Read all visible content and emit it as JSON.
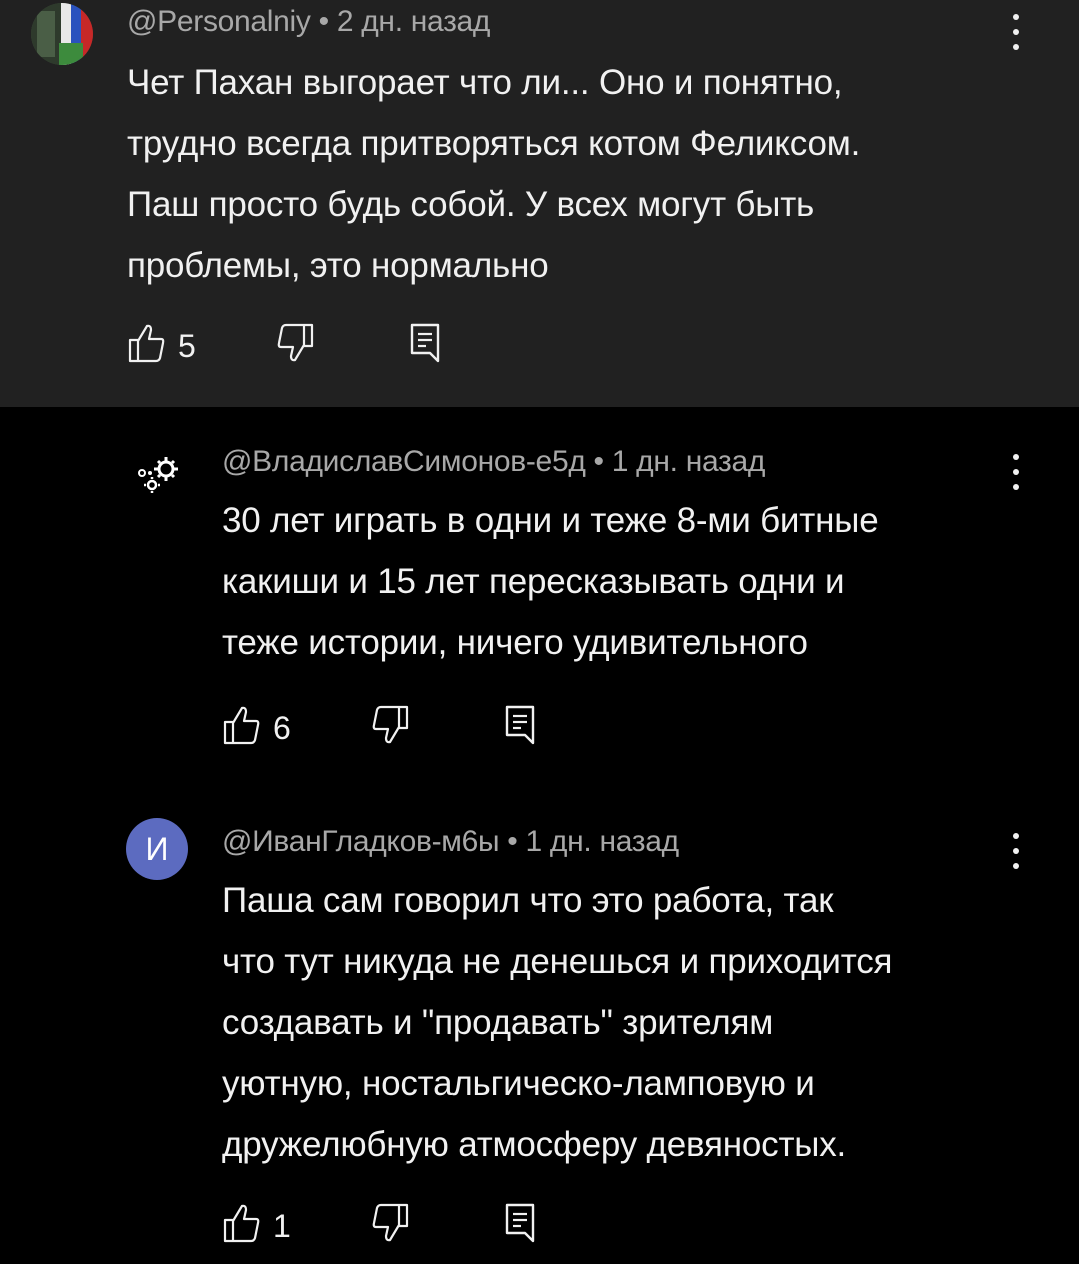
{
  "comments": [
    {
      "author": "@Personalniy",
      "separator": "•",
      "time": "2 дн. назад",
      "text_lines": [
        "Чет Пахан выгорает что ли... Оно и понятно,",
        "трудно всегда притворяться котом Феликсом.",
        "Паш просто будь собой. У всех могут быть",
        "проблемы, это нормально"
      ],
      "likes": "5",
      "avatar_icon": "flag-avatar"
    },
    {
      "author": "@ВладиславСимонов-е5д",
      "separator": "•",
      "time": "1 дн. назад",
      "text_lines": [
        "30 лет играть в одни и теже 8-ми битные",
        "какиши и 15 лет пересказывать одни и",
        "теже истории, ничего удивительного"
      ],
      "likes": "6",
      "avatar_icon": "gears-avatar"
    },
    {
      "author": "@ИванГладков-м6ы",
      "separator": "•",
      "time": "1 дн. назад",
      "text_lines": [
        "Паша сам говорил что это работа, так",
        "что тут никуда не денешься и приходится",
        "создавать и \"продавать\" зрителям",
        "уютную, ностальгическо-ламповую и",
        "дружелюбную атмосферу девяностых."
      ],
      "likes": "1",
      "avatar_letter": "И",
      "avatar_color": "#5c6bc0"
    }
  ],
  "colors": {
    "background": "#000000",
    "highlight_bg": "#212121",
    "meta_text": "#a8a8a8",
    "text": "#f1f1f1"
  }
}
